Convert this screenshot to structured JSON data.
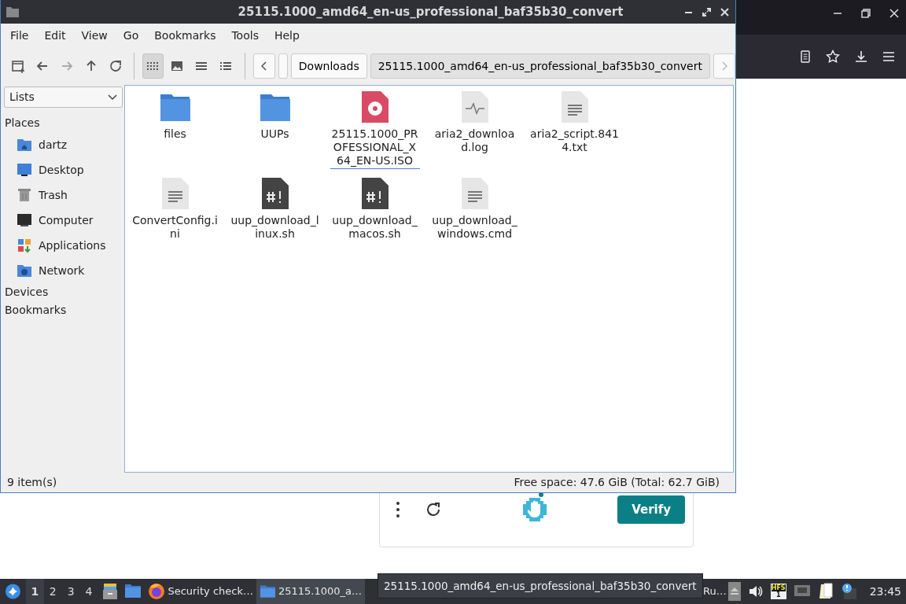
{
  "browser": {
    "captcha": {
      "verify_button": "Verify"
    }
  },
  "file_manager": {
    "title": "25115.1000_amd64_en-us_professional_baf35b30_convert",
    "menu": [
      "File",
      "Edit",
      "View",
      "Go",
      "Bookmarks",
      "Tools",
      "Help"
    ],
    "view_modes": [
      {
        "kind": "icons",
        "selected": true
      },
      {
        "kind": "thumbnails",
        "selected": false
      },
      {
        "kind": "compact",
        "selected": false
      },
      {
        "kind": "details",
        "selected": false
      }
    ],
    "path": [
      "Downloads",
      "25115.1000_amd64_en-us_professional_baf35b30_convert"
    ],
    "sidebar": {
      "dropdown": "Lists",
      "sections": [
        {
          "label": "Places",
          "items": [
            {
              "label": "dartz",
              "kind": "home"
            },
            {
              "label": "Desktop",
              "kind": "desktop"
            },
            {
              "label": "Trash",
              "kind": "trash"
            },
            {
              "label": "Computer",
              "kind": "computer"
            },
            {
              "label": "Applications",
              "kind": "apps"
            },
            {
              "label": "Network",
              "kind": "network"
            }
          ]
        },
        {
          "label": "Devices"
        },
        {
          "label": "Bookmarks"
        }
      ]
    },
    "files": [
      {
        "name": "files",
        "kind": "folder",
        "selected": false
      },
      {
        "name": "UUPs",
        "kind": "folder",
        "selected": false
      },
      {
        "name": "25115.1000_PROFESSIONAL_X64_EN-US.ISO",
        "kind": "disc",
        "selected": true
      },
      {
        "name": "aria2_download.log",
        "kind": "log",
        "selected": false
      },
      {
        "name": "aria2_script.8414.txt",
        "kind": "text",
        "selected": false
      },
      {
        "name": "ConvertConfig.ini",
        "kind": "text",
        "selected": false
      },
      {
        "name": "uup_download_linux.sh",
        "kind": "script",
        "selected": false
      },
      {
        "name": "uup_download_macos.sh",
        "kind": "script",
        "selected": false
      },
      {
        "name": "uup_download_windows.cmd",
        "kind": "text",
        "selected": false
      }
    ],
    "status_left": "9 item(s)",
    "status_right": "Free space: 47.6 GiB (Total: 62.7 GiB)"
  },
  "taskbar": {
    "workspaces": [
      {
        "label": "1",
        "selected": true
      },
      {
        "label": "2",
        "selected": false
      },
      {
        "label": "3",
        "selected": false
      },
      {
        "label": "4",
        "selected": false
      }
    ],
    "tasks": [
      {
        "label": "Security check…",
        "kind": "firefox",
        "active": false
      },
      {
        "label": "25115.1000_a…",
        "kind": "folder",
        "active": true
      },
      {
        "label": "Ru…",
        "kind": "plain",
        "active": false
      }
    ],
    "tooltip": "25115.1000_amd64_en-us_professional_baf35b30_convert",
    "keyboard_indicator": "HFS",
    "keyboard_number": "1",
    "clock": "23:45"
  }
}
